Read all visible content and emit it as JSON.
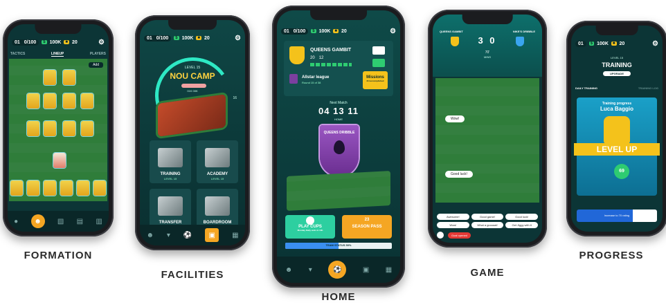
{
  "captions": {
    "formation": "FORMATION",
    "facilities": "FACILITIES",
    "home": "HOME",
    "game": "GAME",
    "progress": "PROGRESS"
  },
  "topbar": {
    "level": "01",
    "progress": "0/100",
    "money": "100K",
    "gold": "20"
  },
  "formation": {
    "tabs": [
      "TACTICS",
      "LINEUP",
      "PLAYERS"
    ],
    "add_label": "Add"
  },
  "facilities": {
    "level_label": "LEVEL 15",
    "stadium_name": "NOU CAMP",
    "capacity": "01K 00K",
    "range_max": "16",
    "tiles": [
      {
        "name": "TRAINING",
        "level": "LEVEL 15"
      },
      {
        "name": "ACADEMY",
        "level": "LEVEL 15"
      },
      {
        "name": "TRANSFER",
        "level": "LEVEL 15"
      },
      {
        "name": "BOARDROOM",
        "level": "LEVEL 15"
      }
    ]
  },
  "home": {
    "team_name": "QUEENS GAMBIT",
    "rating": "20",
    "goals": "12",
    "league_name": "Allstar league",
    "league_round": "Round 15 of 38",
    "missions_label": "Missions",
    "missions_sub": "2/4 accomplished",
    "next_match_label": "Next Match",
    "countdown": "04 13 11",
    "countdown_sub": "HOME",
    "opponent": "QUEENS DRIBBLE",
    "play_cups_title": "PLAY CUPS",
    "play_cups_sub": "Monday Daily ends in 10h",
    "season_pass_title": "SEASON PASS",
    "season_pass_level": "23",
    "team_status": "TEAM STATUS 50%",
    "team_status_value": 0.5
  },
  "game": {
    "home_team": "QUEENS GAMBIT",
    "away_team": "NIKE'S DRIBBLE",
    "score": "3 0",
    "time": "70'",
    "time_label": "MINS",
    "chat_bubbles": [
      "Wow!",
      "Good luck!"
    ],
    "quick_replies": [
      "Awesome!",
      "Good game!",
      "Good luck!",
      "Wow!",
      "What a goooaal!",
      "Get Jiggy with it"
    ],
    "alert_label": "Goal opened"
  },
  "progress": {
    "level_label": "LEVEL 15",
    "title": "TRAINING",
    "upgrade_label": "UPGRADE",
    "tabs": [
      "DAILY TRAINING",
      "TRAINING LOG"
    ],
    "card_heading": "Training progress",
    "player_name": "Luca Baggio",
    "banner": "LEVEL UP",
    "rating": "69",
    "cta": "Increase to 70 rating"
  },
  "colors": {
    "accent_orange": "#f5a623",
    "accent_purple": "#7b3fa0",
    "teal_bg": "#0e3b3b",
    "money_green": "#2ecc71",
    "gold": "#f4c21b"
  }
}
